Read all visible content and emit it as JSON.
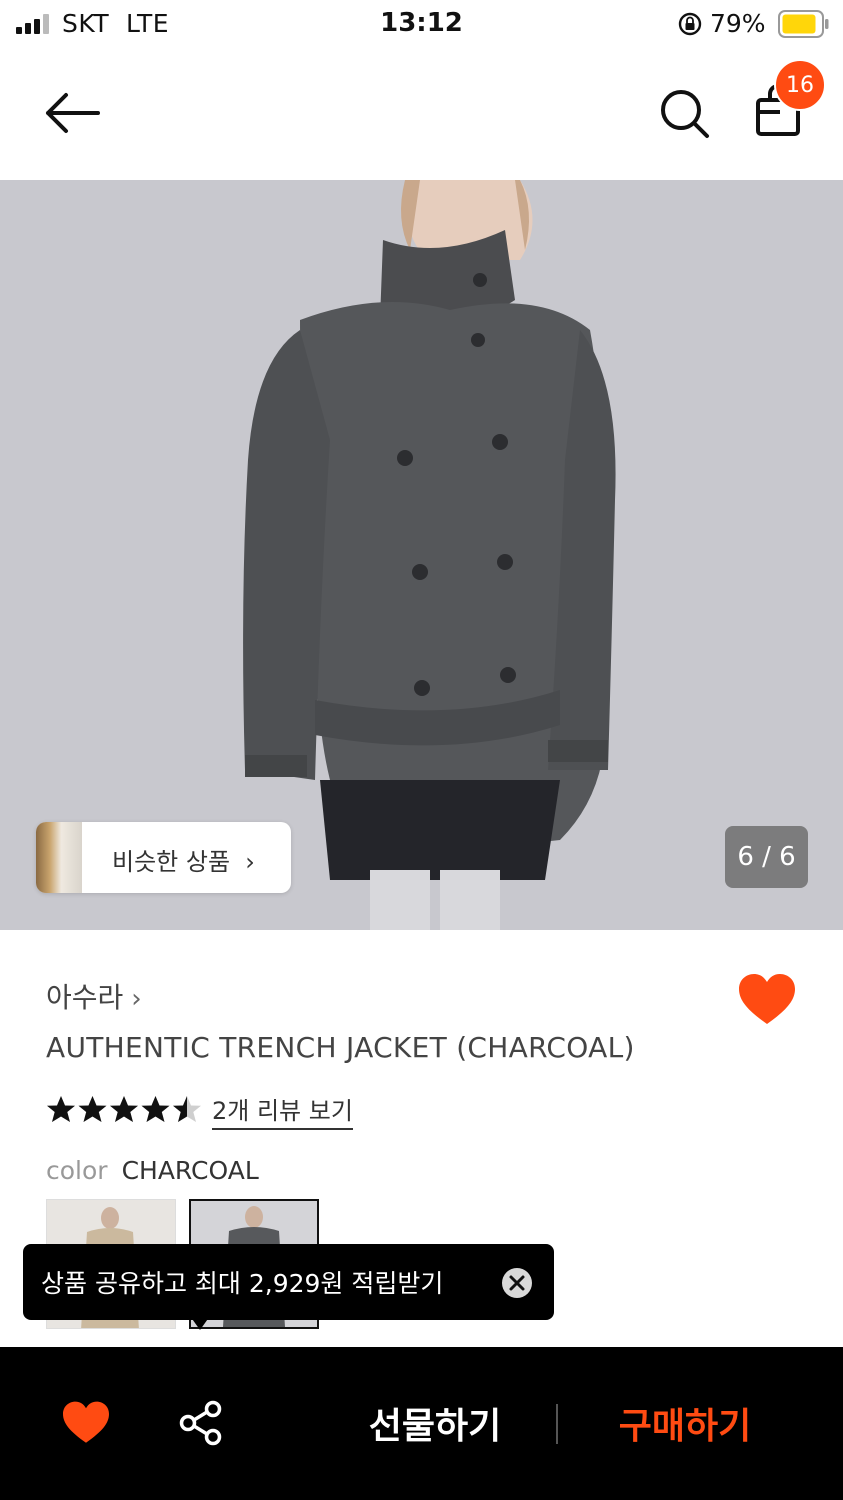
{
  "status_bar": {
    "carrier": "SKT",
    "network": "LTE",
    "time": "13:12",
    "battery": "79%",
    "icons": [
      "signal-icon",
      "orientation-lock-icon",
      "battery-icon"
    ]
  },
  "header": {
    "back_icon": "arrow-left-icon",
    "search_icon": "search-icon",
    "bag_icon": "shopping-bag-icon",
    "cart_count": "16"
  },
  "gallery": {
    "similar_label": "비슷한 상품",
    "similar_chevron": "›",
    "counter": "6 / 6"
  },
  "product": {
    "brand": "아수라",
    "brand_chevron": "›",
    "title": "AUTHENTIC TRENCH JACKET (CHARCOAL)",
    "rating": 4.5,
    "rating_max": 5,
    "review_link": "2개 리뷰 보기",
    "color_key": "color",
    "color_value": "CHARCOAL",
    "liked": true
  },
  "toast": {
    "text": "상품 공유하고 최대 2,929원 적립받기"
  },
  "bottom_bar": {
    "gift_label": "선물하기",
    "buy_label": "구매하기"
  },
  "colors": {
    "accent": "#ff4b12",
    "bottom_bar_bg": "#000000",
    "toast_bg": "#000000"
  }
}
